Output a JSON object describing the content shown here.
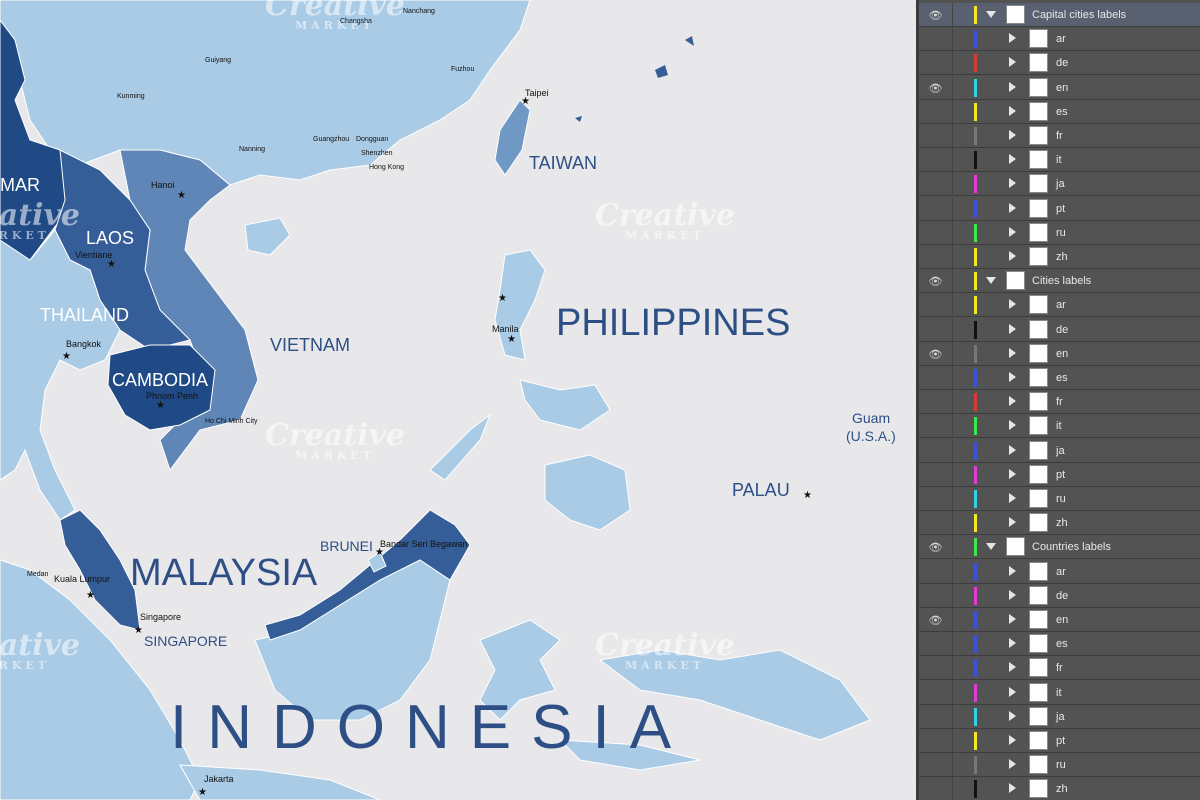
{
  "map": {
    "countries": {
      "myanmar": "MAR",
      "laos": "LAOS",
      "thailand": "THAILAND",
      "cambodia": "CAMBODIA",
      "vietnam": "VIETNAM",
      "philippines": "PHILIPPINES",
      "taiwan": "TAIWAN",
      "malaysia": "MALAYSIA",
      "brunei": "BRUNEI",
      "singapore": "SINGAPORE",
      "indonesia": "INDONESIA",
      "palau": "PALAU",
      "guam": "Guam",
      "guam_sub": "(U.S.A.)"
    },
    "cities": {
      "changsha": "Changsha",
      "nanchang": "Nanchang",
      "guiyang": "Guiyang",
      "fuzhou": "Fuzhou",
      "kunming": "Kunming",
      "taipei": "Taipei",
      "guangzhou": "Guangzhou",
      "dongguan": "Dongguan",
      "nanning": "Nanning",
      "shenzhen": "Shenzhen",
      "hongkong": "Hong Kong",
      "hanoi": "Hanoi",
      "vientiane": "Vientiane",
      "bangkok": "Bangkok",
      "manila": "Manila",
      "phnompenh": "Phnom Penh",
      "hochiminh": "Ho Chi Minh City",
      "bandar": "Bandar Seri Begawan",
      "medan": "Medan",
      "kualalumpur": "Kuala Lumpur",
      "singapore_city": "Singapore",
      "jakarta": "Jakarta"
    },
    "watermark": {
      "text": "Creative",
      "sub": "MARKET"
    },
    "colors": {
      "sea": "#e8e8ea",
      "light": "#a9cbe6",
      "mid": "#5f86b6",
      "dark": "#355e98",
      "darkest": "#1f4a86"
    }
  },
  "layers": {
    "groups": [
      {
        "name": "Capital cities labels",
        "visible": true,
        "selected": true,
        "color": "#f5e629",
        "children": [
          {
            "name": "ar",
            "color": "#3c53d8",
            "visible": false
          },
          {
            "name": "de",
            "color": "#d83a3a",
            "visible": false
          },
          {
            "name": "en",
            "color": "#33d2e8",
            "visible": true
          },
          {
            "name": "es",
            "color": "#f5e629",
            "visible": false
          },
          {
            "name": "fr",
            "color": "#777777",
            "visible": false
          },
          {
            "name": "it",
            "color": "#111111",
            "visible": false
          },
          {
            "name": "ja",
            "color": "#e23ad8",
            "visible": false
          },
          {
            "name": "pt",
            "color": "#3c53d8",
            "visible": false
          },
          {
            "name": "ru",
            "color": "#3ce84a",
            "visible": false
          },
          {
            "name": "zh",
            "color": "#f5e629",
            "visible": false
          }
        ]
      },
      {
        "name": "Cities labels",
        "visible": true,
        "selected": false,
        "color": "#f5e629",
        "children": [
          {
            "name": "ar",
            "color": "#f5e629",
            "visible": false
          },
          {
            "name": "de",
            "color": "#111111",
            "visible": false
          },
          {
            "name": "en",
            "color": "#777777",
            "visible": true
          },
          {
            "name": "es",
            "color": "#3c53d8",
            "visible": false
          },
          {
            "name": "fr",
            "color": "#d83a3a",
            "visible": false
          },
          {
            "name": "it",
            "color": "#3ce84a",
            "visible": false
          },
          {
            "name": "ja",
            "color": "#3c53d8",
            "visible": false
          },
          {
            "name": "pt",
            "color": "#e23ad8",
            "visible": false
          },
          {
            "name": "ru",
            "color": "#33d2e8",
            "visible": false
          },
          {
            "name": "zh",
            "color": "#f5e629",
            "visible": false
          }
        ]
      },
      {
        "name": "Countries labels",
        "visible": true,
        "selected": false,
        "color": "#3ce84a",
        "children": [
          {
            "name": "ar",
            "color": "#3c53d8",
            "visible": false
          },
          {
            "name": "de",
            "color": "#e23ad8",
            "visible": false
          },
          {
            "name": "en",
            "color": "#3c53d8",
            "visible": true
          },
          {
            "name": "es",
            "color": "#3c53d8",
            "visible": false
          },
          {
            "name": "fr",
            "color": "#3c53d8",
            "visible": false
          },
          {
            "name": "it",
            "color": "#e23ad8",
            "visible": false
          },
          {
            "name": "ja",
            "color": "#33d2e8",
            "visible": false
          },
          {
            "name": "pt",
            "color": "#f5e629",
            "visible": false
          },
          {
            "name": "ru",
            "color": "#777777",
            "visible": false
          },
          {
            "name": "zh",
            "color": "#111111",
            "visible": false
          }
        ]
      }
    ]
  }
}
